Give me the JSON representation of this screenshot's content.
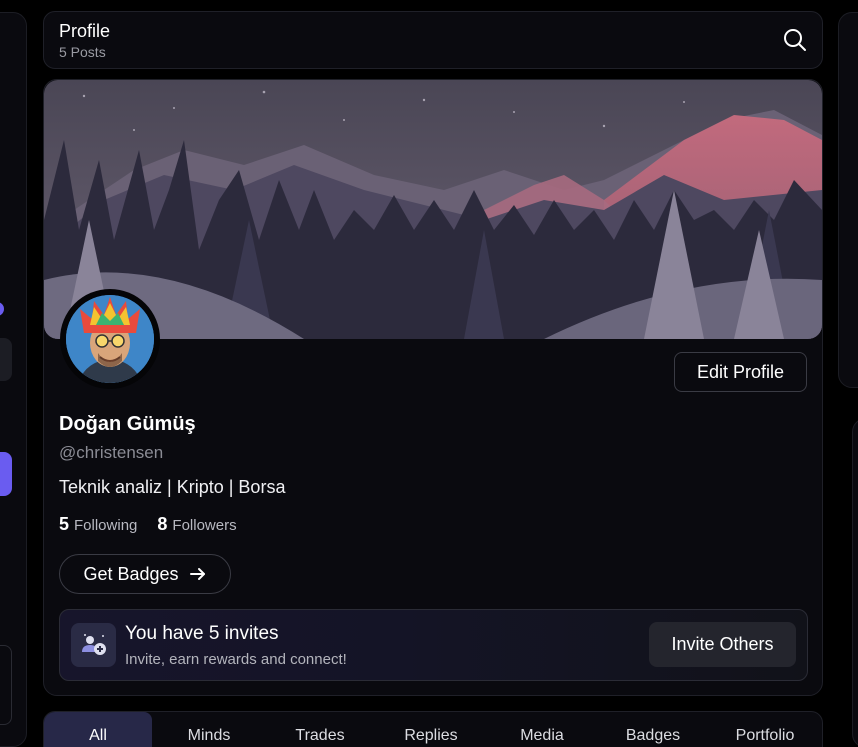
{
  "header": {
    "title": "Profile",
    "subtitle": "5 Posts"
  },
  "profile": {
    "name": "Doğan Gümüş",
    "handle": "@christensen",
    "bio": "Teknik analiz | Kripto | Borsa",
    "following_count": "5",
    "following_label": "Following",
    "followers_count": "8",
    "followers_label": "Followers",
    "edit_label": "Edit Profile",
    "badges_label": "Get Badges"
  },
  "invite": {
    "title": "You have 5 invites",
    "subtitle": "Invite, earn rewards and connect!",
    "button": "Invite Others"
  },
  "tabs": [
    "All",
    "Minds",
    "Trades",
    "Replies",
    "Media",
    "Badges",
    "Portfolio"
  ],
  "colors": {
    "accent": "#6a5cf0",
    "background": "#0a0a0f",
    "active_tab": "#272848"
  },
  "icons": {
    "search": "search-icon",
    "arrow": "arrow-right-icon",
    "invite": "invite-users-icon"
  }
}
